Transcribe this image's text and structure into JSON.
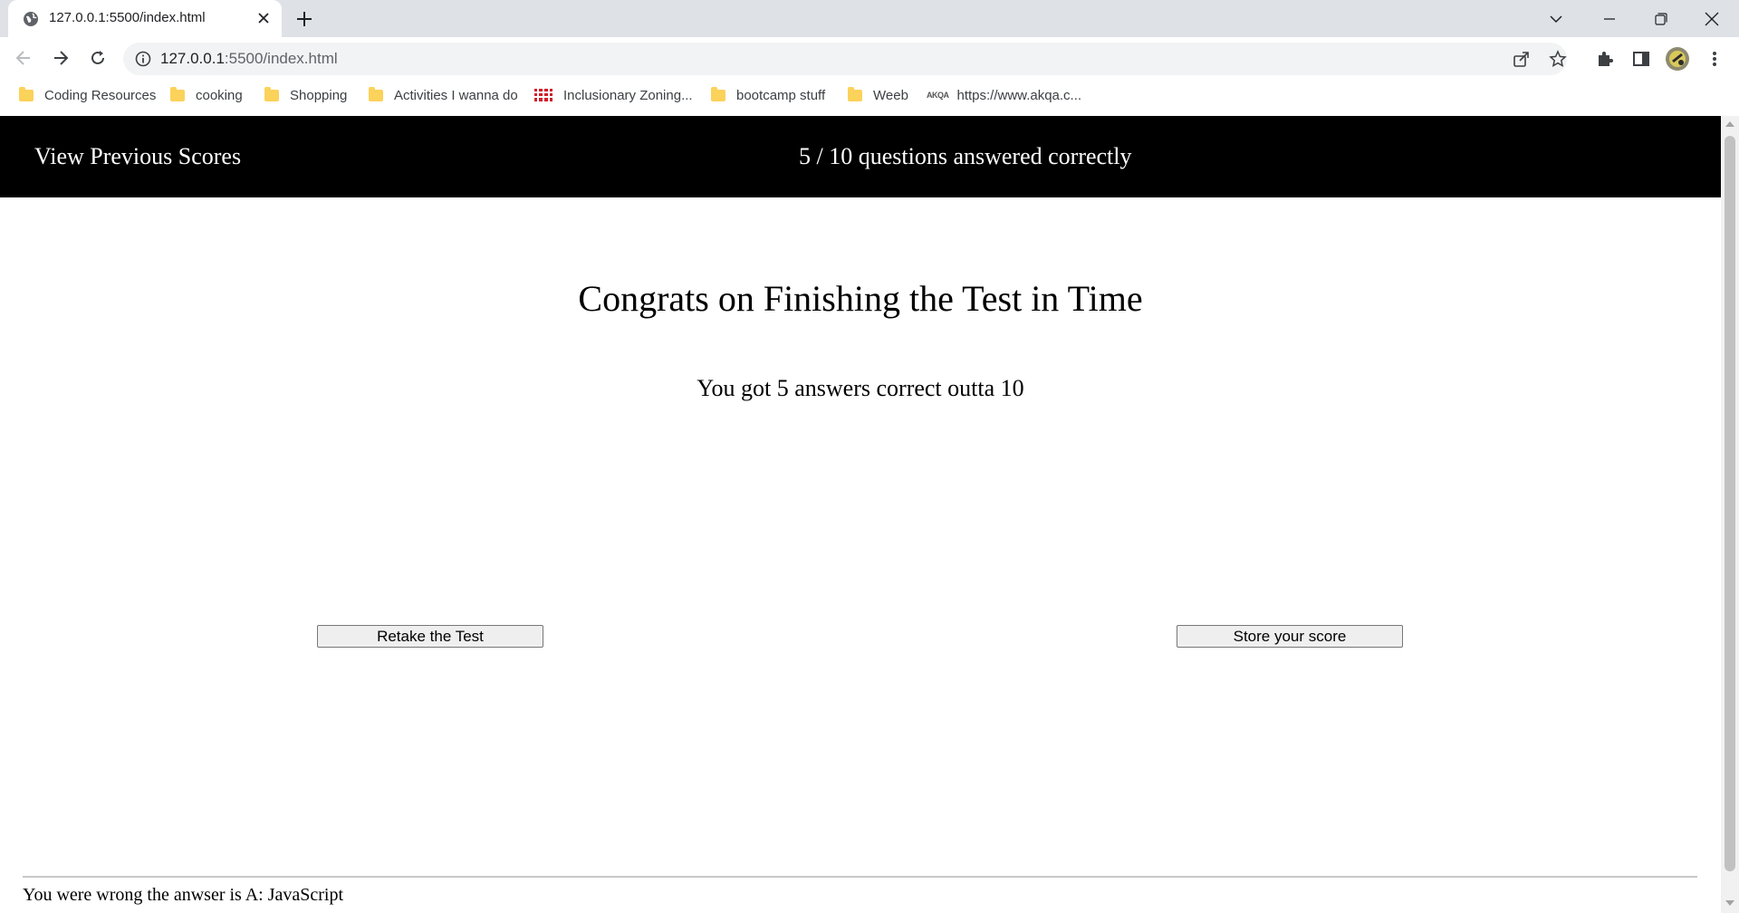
{
  "browser": {
    "tab_title": "127.0.0.1:5500/index.html",
    "url_host": "127.0.0.1",
    "url_rest": ":5500/index.html",
    "bookmarks": [
      {
        "label": "Coding Resources",
        "icon": "folder-icon"
      },
      {
        "label": "cooking",
        "icon": "folder-icon"
      },
      {
        "label": "Shopping",
        "icon": "folder-icon"
      },
      {
        "label": "Activities I wanna do",
        "icon": "folder-icon"
      },
      {
        "label": "Inclusionary Zoning...",
        "icon": "site-favicon-icon"
      },
      {
        "label": "bootcamp stuff",
        "icon": "folder-icon"
      },
      {
        "label": "Weeb",
        "icon": "folder-icon"
      },
      {
        "label": "https://www.akqa.c...",
        "icon": "akqa-favicon-icon"
      }
    ],
    "akqa_favicon_text": "AKQA"
  },
  "header": {
    "view_scores": "View Previous Scores",
    "score": "5 / 10 questions answered correctly"
  },
  "main": {
    "title": "Congrats on Finishing the Test in Time",
    "result": "You got 5 answers correct outta 10",
    "retake_label": "Retake the Test",
    "store_label": "Store your score"
  },
  "footer": {
    "feedback": "You were wrong the anwser is A: JavaScript"
  },
  "colors": {
    "header_bg": "#000000",
    "folder": "#fbd25a",
    "tabbar_bg": "#dee1e6"
  }
}
